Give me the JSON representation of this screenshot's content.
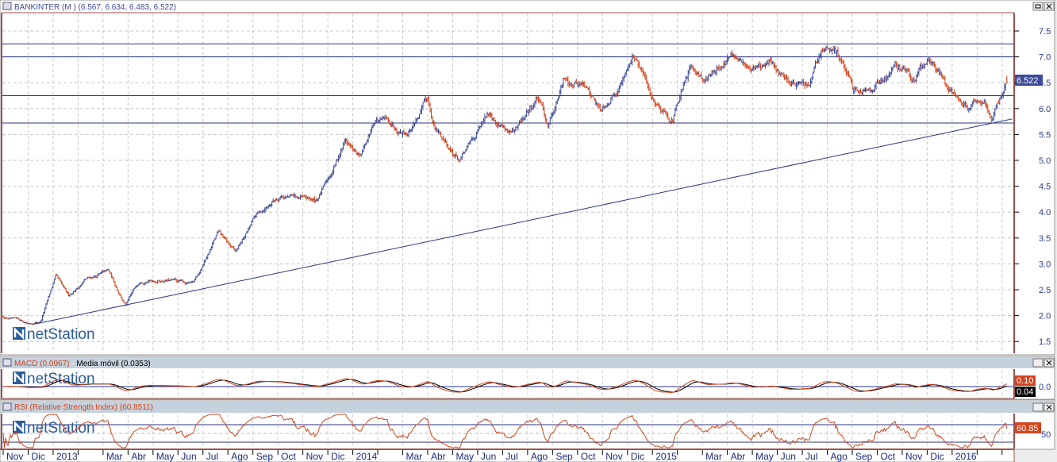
{
  "main_panel": {
    "title": "BANKINTER (M ) (6.567, 6.634, 6.483, 6.522)",
    "last_price_label": "6.522",
    "watermark": "netStation"
  },
  "macd_panel": {
    "title_macd": "MACD (0.0967)",
    "title_separator": " - ",
    "title_signal": "Media móvil (0.0353)",
    "macd_label": "0.10",
    "signal_label": "0.04",
    "axis_label": "0.0",
    "watermark": "netStation"
  },
  "rsi_panel": {
    "title": "RSI (Relative Strength Index) (60.8511)",
    "value_label": "60.85",
    "axis_label": "50",
    "watermark": "netStation"
  },
  "colors": {
    "up": "#3b4a9a",
    "down": "#d2451e",
    "line": "#2a3480",
    "macd": "#d2451e",
    "signal": "#000000"
  },
  "chart_data": {
    "type": "line",
    "title": "BANKINTER (M )",
    "ylim": [
      1.3,
      7.8
    ],
    "yticks": [
      "1.5",
      "2.0",
      "2.5",
      "3.0",
      "3.5",
      "4.0",
      "4.5",
      "5.0",
      "5.5",
      "6.0",
      "6.5",
      "7.0",
      "7.5"
    ],
    "x_labels": [
      "Nov",
      "Dic",
      "2013",
      "",
      "Mar",
      "Abr",
      "May",
      "Jun",
      "Jul",
      "Ago",
      "Sep",
      "Oct",
      "Nov",
      "Dic",
      "2014",
      "",
      "Mar",
      "Abr",
      "May",
      "Jun",
      "Jul",
      "Ago",
      "Sep",
      "Oct",
      "Nov",
      "Dic",
      "2015",
      "",
      "Mar",
      "Abr",
      "May",
      "Jun",
      "Jul",
      "Ago",
      "Sep",
      "Oct",
      "Nov",
      "Dic",
      "2016",
      "",
      ""
    ],
    "price_path_month_index": [
      0,
      1,
      1.5,
      2.1,
      2.6,
      3.3,
      4.2,
      4.9,
      5.5,
      6.5,
      7.6,
      8.6,
      9.3,
      10.1,
      11.1,
      12.5,
      13.0,
      13.7,
      14.3,
      14.9,
      16.2,
      17.0,
      17.3,
      18.3,
      19.5,
      20.5,
      21.4,
      21.8,
      22.5,
      23.2,
      23.9,
      24.8,
      25.2,
      26.0,
      26.8,
      27.6,
      28.2,
      29.1,
      29.6,
      30.7,
      31.5,
      32.3,
      32.8,
      33.6,
      34.0,
      34.8,
      35.4,
      35.7,
      36.5,
      37.0,
      37.9,
      38.7,
      39.3,
      39.6,
      40.2
    ],
    "price_path_values": [
      1.98,
      1.85,
      1.9,
      2.75,
      2.35,
      2.7,
      2.85,
      2.2,
      2.7,
      2.7,
      2.6,
      3.6,
      3.2,
      3.9,
      4.35,
      4.2,
      4.6,
      5.4,
      5.0,
      5.8,
      5.6,
      6.15,
      5.6,
      5.0,
      5.9,
      5.5,
      6.2,
      5.7,
      6.6,
      6.5,
      6.0,
      6.6,
      7.1,
      6.2,
      5.85,
      6.8,
      6.6,
      7.05,
      6.8,
      6.85,
      6.55,
      6.4,
      7.15,
      6.95,
      6.3,
      6.5,
      6.6,
      6.95,
      6.6,
      6.9,
      6.5,
      5.95,
      6.2,
      5.8,
      6.52
    ],
    "last_ohlc": {
      "open": 6.567,
      "high": 6.634,
      "low": 6.483,
      "close": 6.522
    },
    "horizontal_levels": [
      7.25,
      7.0,
      6.25,
      5.72
    ],
    "trendline": {
      "from": [
        1.3,
        1.84
      ],
      "to": [
        40.4,
        5.8
      ]
    },
    "macd": {
      "macd": 0.0967,
      "signal": 0.0353
    },
    "rsi": {
      "value": 60.8511,
      "levels": [
        70,
        50,
        30
      ]
    }
  }
}
